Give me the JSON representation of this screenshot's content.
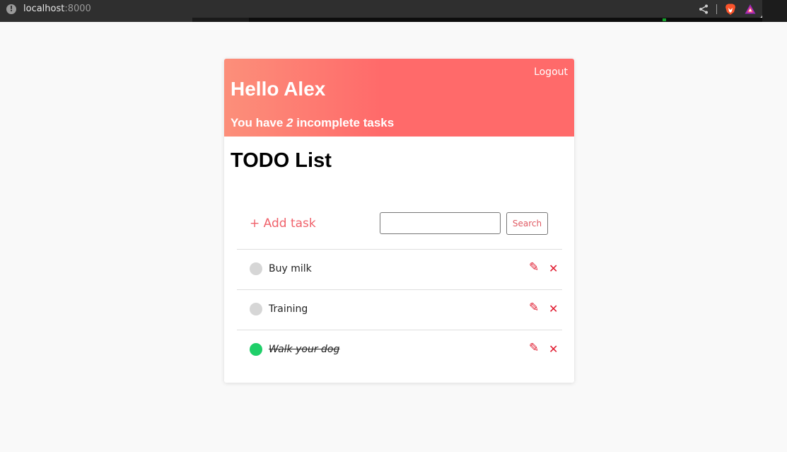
{
  "browser": {
    "url_host": "localhost",
    "url_port": ":8000",
    "info_glyph": "!",
    "icons": [
      "info-icon",
      "share-icon",
      "brave-icon",
      "rewards-icon"
    ]
  },
  "header": {
    "logout_label": "Logout",
    "greeting": "Hello Alex",
    "subtitle_prefix": "You have ",
    "incomplete_count": "2",
    "subtitle_suffix": " incomplete tasks",
    "gradient_start": "#fc8f7a",
    "gradient_end": "#ff6a6a"
  },
  "main": {
    "title": "TODO List",
    "add_task_label": "+ Add task",
    "search": {
      "value": "",
      "placeholder": "",
      "button_label": "Search"
    },
    "tasks": [
      {
        "label": "Buy milk",
        "completed": false
      },
      {
        "label": "Training",
        "completed": false
      },
      {
        "label": "Walk your dog",
        "completed": true
      }
    ],
    "edit_glyph": "✎",
    "delete_glyph": "✕"
  },
  "colors": {
    "accent": "#f0626b",
    "action_red": "#e01a2f",
    "done_green": "#1fcf69",
    "todo_gray": "#d6d6d6"
  }
}
